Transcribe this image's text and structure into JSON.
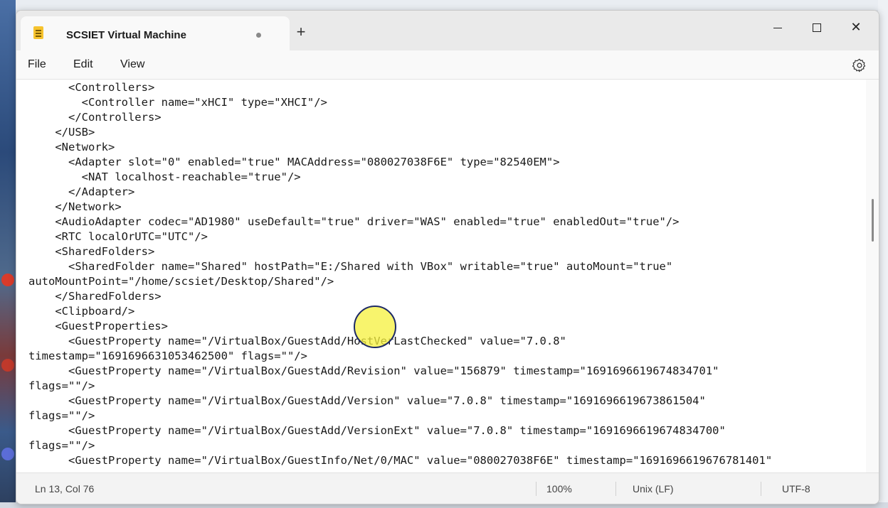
{
  "window": {
    "tab_title": "SCSIET Virtual Machine",
    "new_tab_symbol": "+",
    "close_symbol": "✕"
  },
  "menu": {
    "file": "File",
    "edit": "Edit",
    "view": "View"
  },
  "editor_lines": [
    "      <Controllers>",
    "        <Controller name=\"xHCI\" type=\"XHCI\"/>",
    "      </Controllers>",
    "    </USB>",
    "    <Network>",
    "      <Adapter slot=\"0\" enabled=\"true\" MACAddress=\"080027038F6E\" type=\"82540EM\">",
    "        <NAT localhost-reachable=\"true\"/>",
    "      </Adapter>",
    "    </Network>",
    "    <AudioAdapter codec=\"AD1980\" useDefault=\"true\" driver=\"WAS\" enabled=\"true\" enabledOut=\"true\"/>",
    "    <RTC localOrUTC=\"UTC\"/>",
    "    <SharedFolders>",
    "      <SharedFolder name=\"Shared\" hostPath=\"E:/Shared with VBox\" writable=\"true\" autoMount=\"true\"",
    "autoMountPoint=\"/home/scsiet/Desktop/Shared\"/>",
    "    </SharedFolders>",
    "    <Clipboard/>",
    "    <GuestProperties>",
    "      <GuestProperty name=\"/VirtualBox/GuestAdd/HostVerLastChecked\" value=\"7.0.8\"",
    "timestamp=\"1691696631053462500\" flags=\"\"/>",
    "      <GuestProperty name=\"/VirtualBox/GuestAdd/Revision\" value=\"156879\" timestamp=\"1691696619674834701\"",
    "flags=\"\"/>",
    "      <GuestProperty name=\"/VirtualBox/GuestAdd/Version\" value=\"7.0.8\" timestamp=\"1691696619673861504\"",
    "flags=\"\"/>",
    "      <GuestProperty name=\"/VirtualBox/GuestAdd/VersionExt\" value=\"7.0.8\" timestamp=\"1691696619674834700\"",
    "flags=\"\"/>",
    "      <GuestProperty name=\"/VirtualBox/GuestInfo/Net/0/MAC\" value=\"080027038F6E\" timestamp=\"1691696619676781401\""
  ],
  "status": {
    "position": "Ln 13, Col 76",
    "zoom": "100%",
    "line_ending": "Unix (LF)",
    "encoding": "UTF-8"
  }
}
